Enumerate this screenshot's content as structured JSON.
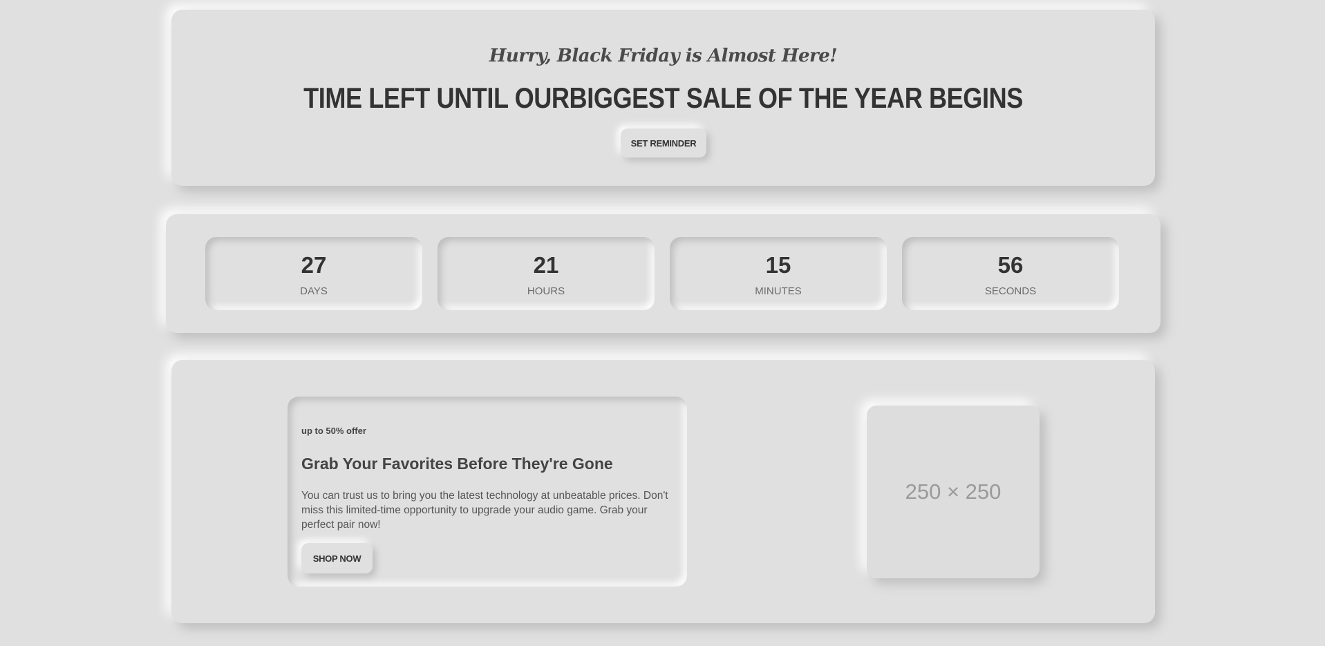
{
  "hero": {
    "tagline": "Hurry, Black Friday is Almost Here!",
    "headline": "TIME LEFT UNTIL OURBIGGEST SALE OF THE YEAR BEGINS",
    "reminder_label": "SET REMINDER"
  },
  "countdown": {
    "units": [
      {
        "value": "27",
        "label": "DAYS"
      },
      {
        "value": "21",
        "label": "HOURS"
      },
      {
        "value": "15",
        "label": "MINUTES"
      },
      {
        "value": "56",
        "label": "SECONDS"
      }
    ]
  },
  "promo": {
    "kicker": "up to 50% offer",
    "title": "Grab Your Favorites Before They're Gone",
    "description": "You can trust us to bring you the latest technology at unbeatable prices. Don't miss this limited-time opportunity to upgrade your audio game. Grab your perfect pair now!",
    "shop_label": "SHOP NOW",
    "image_placeholder": "250 × 250"
  },
  "colors": {
    "background": "#e0e0e0",
    "text_dark": "#333333",
    "text_muted": "#6b6b6b"
  }
}
